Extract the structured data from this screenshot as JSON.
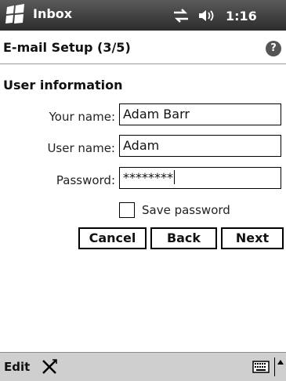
{
  "titlebar": {
    "app_title": "Inbox",
    "clock": "1:16",
    "icons": [
      "start-icon",
      "connectivity-icon",
      "volume-icon"
    ]
  },
  "header": {
    "title": "E-mail Setup (3/5)",
    "help_glyph": "?"
  },
  "form": {
    "section_title": "User information",
    "your_name_label": "Your name:",
    "your_name_value": "Adam Barr",
    "user_name_label": "User name:",
    "user_name_value": "Adam",
    "password_label": "Password:",
    "password_value": "********",
    "save_password_label": "Save password",
    "save_password_checked": false
  },
  "buttons": {
    "cancel": "Cancel",
    "back": "Back",
    "next": "Next"
  },
  "menubar": {
    "edit": "Edit",
    "icons": [
      "tools-icon",
      "keyboard-icon",
      "sip-arrow-icon"
    ]
  }
}
